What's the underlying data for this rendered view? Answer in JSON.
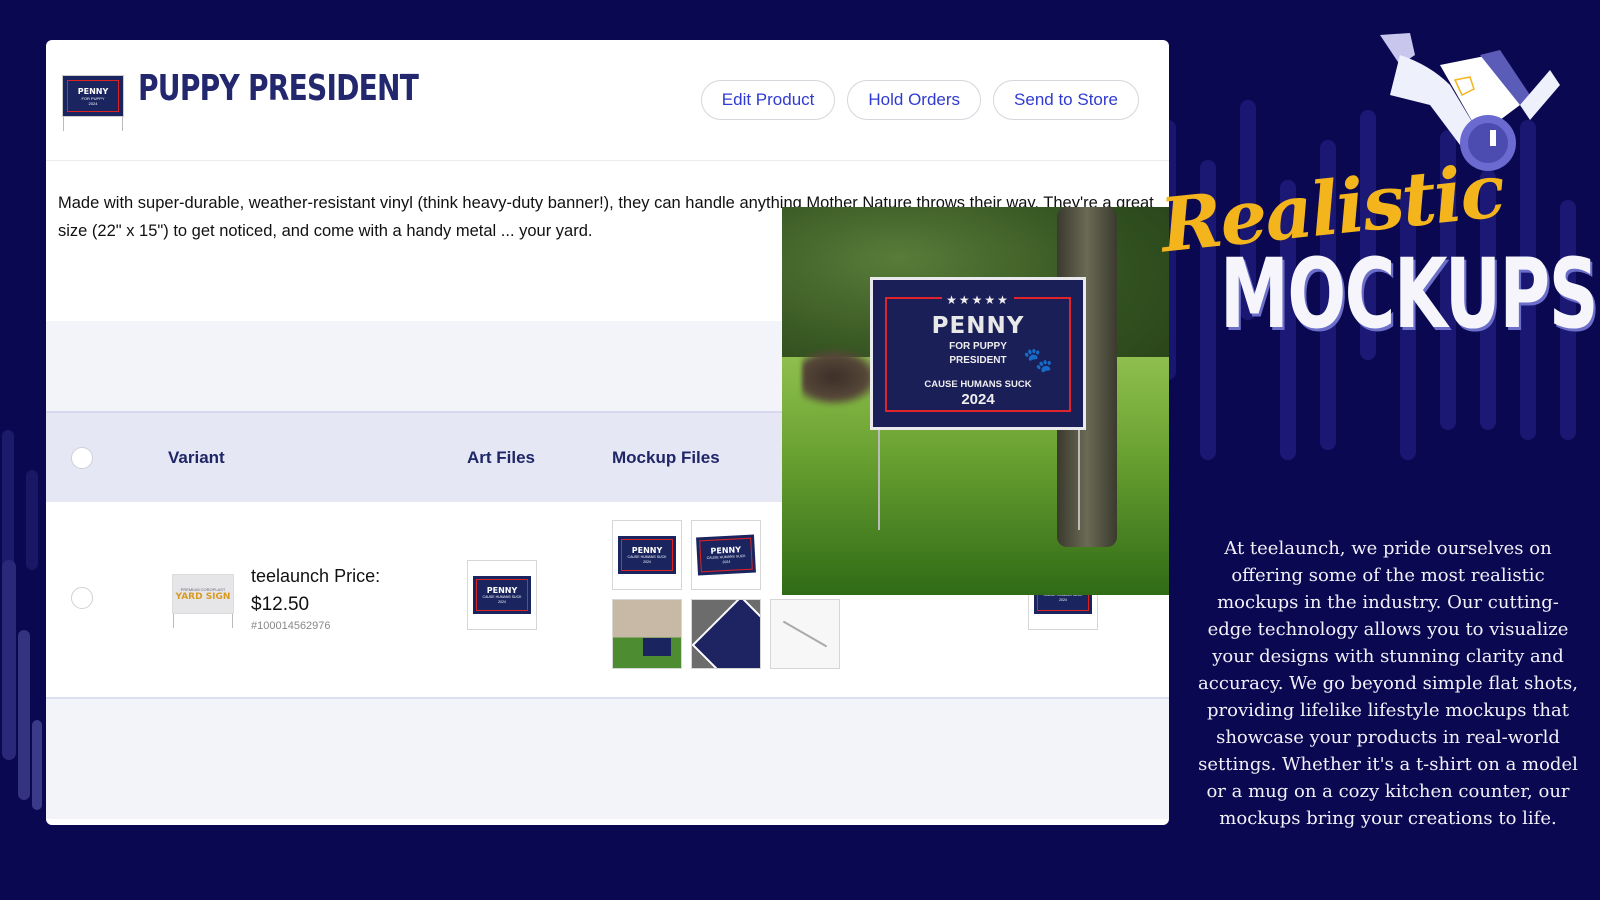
{
  "product": {
    "title": "PUPPY PRESIDENT",
    "thumbnail_icon": "yard-sign-thumbnail",
    "actions": {
      "edit_label": "Edit Product",
      "hold_label": "Hold Orders",
      "send_label": "Send to Store"
    },
    "description": "Made with super-durable, weather-resistant vinyl (think heavy-duty banner!), they can handle anything Mother Nature throws their way. They're a great size (22\" x 15\") to get noticed, and come with a handy metal ... your yard."
  },
  "table": {
    "headers": {
      "variant": "Variant",
      "art_files": "Art Files",
      "mockup_files": "Mockup Files"
    },
    "rows": [
      {
        "variant_thumb_text": "YARD SIGN",
        "variant_thumb_small": "PREMIUM COROPLAST",
        "price_label": "teelaunch Price:",
        "price": "$12.50",
        "sku": "#100014562976",
        "mockups": [
          "flat-sign",
          "angled-sign",
          "house-lawn",
          "corner-closeup",
          "metal-stake"
        ]
      }
    ]
  },
  "sign": {
    "stars": "★★★★★",
    "name": "PENNY",
    "line1": "FOR PUPPY",
    "line2": "PRESIDENT",
    "cause": "CAUSE HUMANS SUCK",
    "year": "2024",
    "paw_icon": "🐾"
  },
  "promo": {
    "script_title": "Realistic",
    "block_title": "MOCKUPS",
    "body": "At teelaunch, we pride ourselves on offering some of the most realistic mockups in the industry. Our cutting-edge technology allows you to visualize your designs with stunning clarity and accuracy. We go beyond simple flat shots, providing lifelike lifestyle mockups that showcase your products in real-world settings. Whether it's a t-shirt on a model or a mug on a cozy kitchen counter, our mockups bring your creations to life."
  },
  "colors": {
    "background": "#0b0852",
    "title_navy": "#23286e",
    "button_text": "#2f3bd0",
    "accent_gold": "#f4b51c",
    "sign_navy": "#1a1f58",
    "sign_red": "#e0242b"
  }
}
